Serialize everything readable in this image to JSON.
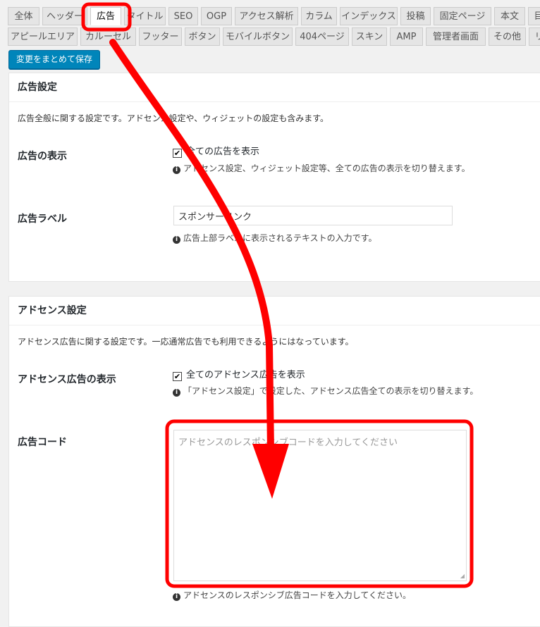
{
  "tabs_row1": [
    "全体",
    "ヘッダー",
    "広告",
    "タイトル",
    "SEO",
    "OGP",
    "アクセス解析",
    "カラム",
    "インデックス",
    "投稿",
    "固定ページ",
    "本文",
    "目"
  ],
  "tabs_row2": [
    "アピールエリア",
    "カルーセル",
    "フッター",
    "ボタン",
    "モバイルボタン",
    "404ページ",
    "スキン",
    "AMP",
    "管理者画面",
    "その他",
    "リ"
  ],
  "save_label": "変更をまとめて保存",
  "ad_settings": {
    "title": "広告設定",
    "description": "広告全般に関する設定です。アドセンス設定や、ウィジェットの設定も含みます。",
    "display_label": "広告の表示",
    "display_checkbox": "全ての広告を表示",
    "display_help": "アドセンス設定、ウィジェット設定等、全ての広告の表示を切り替えます。",
    "ad_label_label": "広告ラベル",
    "ad_label_value": "スポンサーリンク",
    "ad_label_help": "広告上部ラベルに表示されるテキストの入力です。"
  },
  "adsense_settings": {
    "title": "アドセンス設定",
    "description": "アドセンス広告に関する設定です。一応通常広告でも利用できるようにはなっています。",
    "display_label": "アドセンス広告の表示",
    "display_checkbox": "全てのアドセンス広告を表示",
    "display_help": "「アドセンス設定」で設定した、アドセンス広告全ての表示を切り替えます。",
    "code_label": "広告コード",
    "code_placeholder": "アドセンスのレスポンシブコードを入力してください",
    "code_help": "アドセンスのレスポンシブ広告コードを入力してください。"
  },
  "colors": {
    "accent": "#0085ba",
    "annotation": "#ff0000"
  }
}
